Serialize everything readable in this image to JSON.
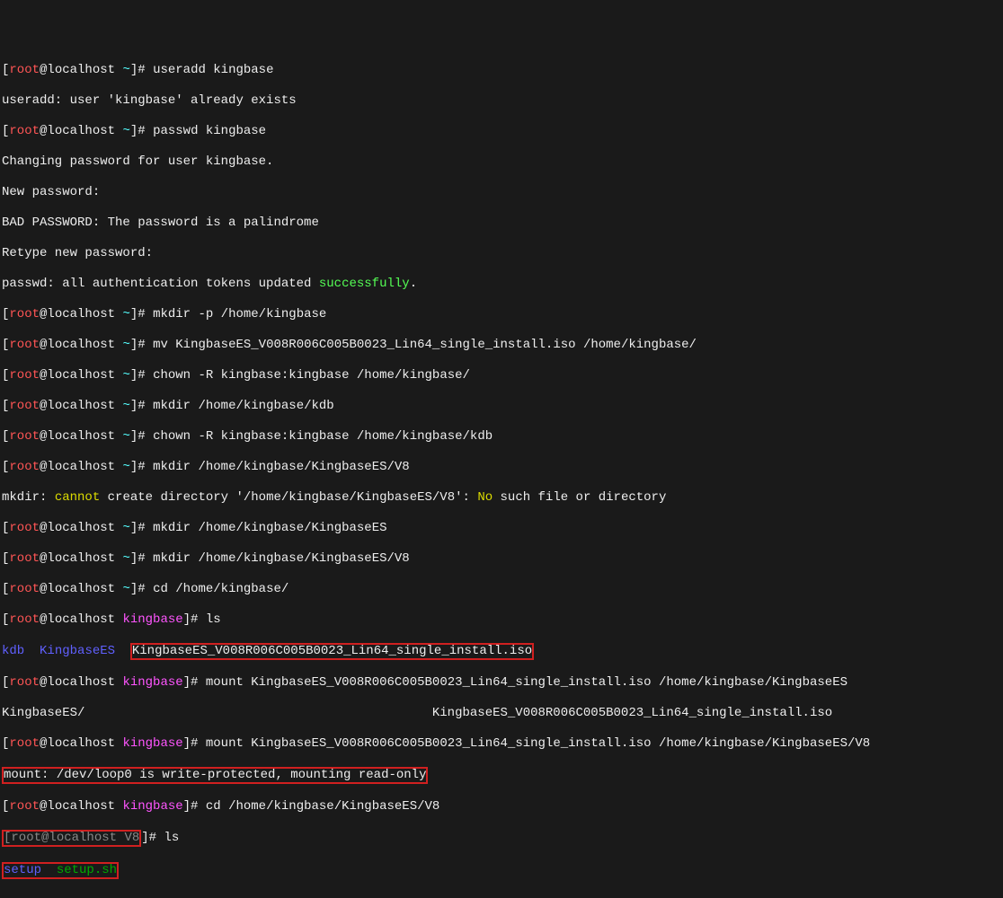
{
  "p": {
    "lb": "[",
    "user": "root",
    "at": "@localhost ",
    "tilde": "~",
    "rb": "]# ",
    "kingbase": "kingbase",
    "v8": "V8"
  },
  "cmd": {
    "useradd": "useradd kingbase",
    "useradd_err": "useradd: user 'kingbase' already exists",
    "passwd": "passwd kingbase",
    "chg": "Changing password for user kingbase.",
    "newpw": "New password:",
    "badpw": "BAD PASSWORD: The password is a palindrome",
    "retype": "Retype new password:",
    "passwd_pre": "passwd: all authentication tokens updated ",
    "success": "successfully",
    "dot": ".",
    "mkdir1": "mkdir -p /home/kingbase",
    "mv": "mv KingbaseES_V008R006C005B0023_Lin64_single_install.iso /home/kingbase/",
    "chown1": "chown -R kingbase:kingbase /home/kingbase/",
    "mkdir2": "mkdir /home/kingbase/kdb",
    "chown2": "chown -R kingbase:kingbase /home/kingbase/kdb",
    "mkdir3": "mkdir /home/kingbase/KingbaseES/V8",
    "mkdir_err1": "mkdir: ",
    "mkdir_err2": "cannot",
    "mkdir_err3": " create directory '/home/kingbase/KingbaseES/V8': ",
    "mkdir_err4": "No",
    "mkdir_err5": " such file or directory",
    "mkdir4": "mkdir /home/kingbase/KingbaseES",
    "mkdir5": "mkdir /home/kingbase/KingbaseES/V8",
    "cd1": "cd /home/kingbase/",
    "ls": "ls",
    "kdb": "kdb",
    "kb_es": "KingbaseES",
    "iso": "KingbaseES_V008R006C005B0023_Lin64_single_install.iso",
    "mount1": "mount KingbaseES_V008R006C005B0023_Lin64_single_install.iso /home/kingbase/KingbaseES",
    "tab_line1": "KingbaseES/                                              KingbaseES_V008R006C005B0023_Lin64_single_install.iso",
    "mount2": "mount KingbaseES_V008R006C005B0023_Lin64_single_install.iso /home/kingbase/KingbaseES/V8",
    "mount_msg": "mount: /dev/loop0 is write-protected, mounting read-only",
    "cd2": "cd /home/kingbase/KingbaseES/V8",
    "setup": "setup",
    "setup_sh": "setup.sh"
  }
}
